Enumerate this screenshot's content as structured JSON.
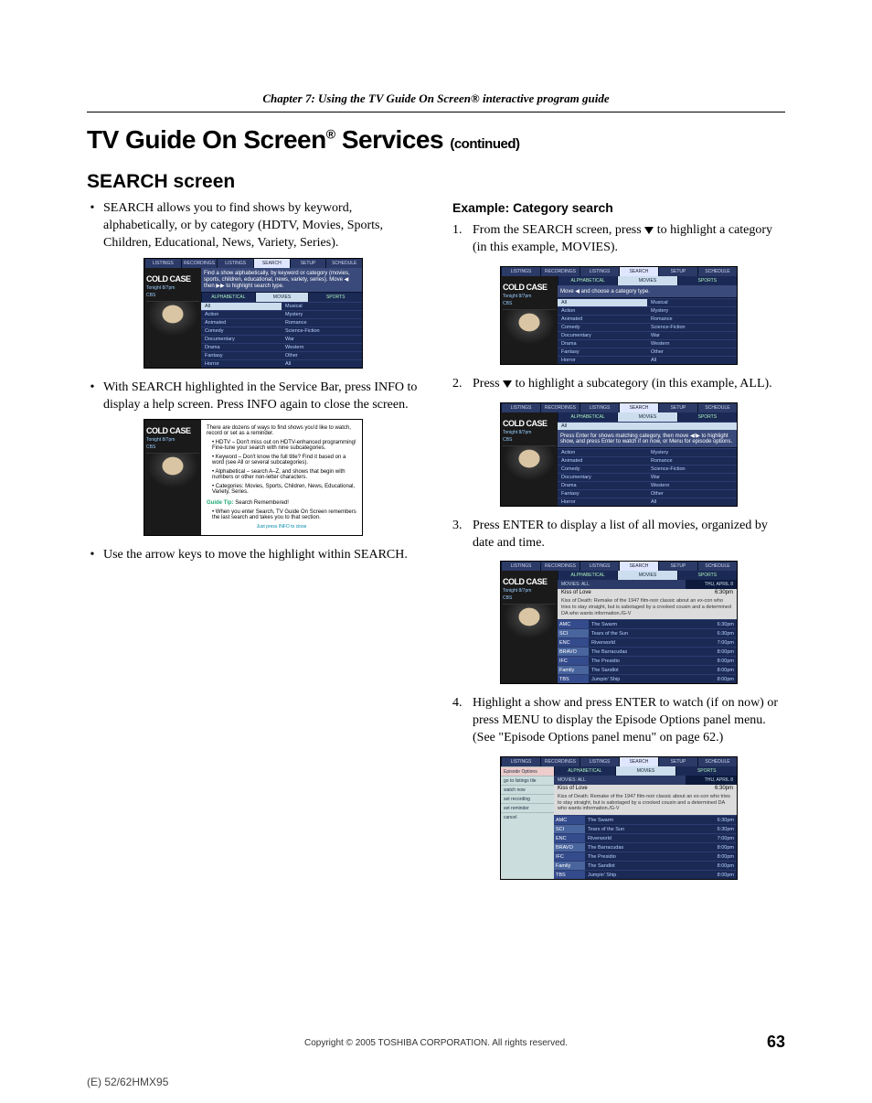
{
  "chapter_head": "Chapter 7: Using the TV Guide On Screen® interactive program guide",
  "section_title_a": "TV Guide On Screen",
  "section_title_b": " Services ",
  "section_title_cont": "(continued)",
  "search_heading": "SEARCH screen",
  "left": {
    "b1": "SEARCH allows you to find shows by keyword, alphabetically, or by category (HDTV, Movies, Sports, Children, Educational, News, Variety, Series).",
    "b2": "With SEARCH highlighted in the Service Bar, press INFO to display a help screen. Press INFO again to close the screen.",
    "b3": "Use the arrow keys to move the highlight within SEARCH."
  },
  "right": {
    "example_head": "Example: Category search",
    "s1a": "From the SEARCH screen, press ",
    "s1b": " to highlight a category (in this example, MOVIES).",
    "s2a": "Press ",
    "s2b": " to highlight a subcategory (in this example, ALL).",
    "s3": "Press ENTER to display a list of all movies, organized by date and time.",
    "s4": "Highlight a show and press ENTER to watch (if on now) or press MENU to display the Episode Options panel menu. (See \"Episode Options panel menu\" on page 62.)"
  },
  "shot_common": {
    "topbar": [
      "LISTINGS",
      "RECORDINGS",
      "LISTINGS",
      "SEARCH",
      "SETUP",
      "SCHEDULE"
    ],
    "catbar": [
      "ALPHABETICAL",
      "MOVIES",
      "SPORTS"
    ],
    "promo_title": "COLD CASE",
    "promo_sub": "Tonight 8/7pm",
    "promo_net": "CBS"
  },
  "shot1": {
    "hint": "Find a show alphabetically, by keyword or category (movies, sports, children, educational, news, variety, series). Move ◀ then ▶▶ to highlight search type.",
    "grid_left": [
      "All",
      "Action",
      "Animated",
      "Comedy",
      "Documentary",
      "Drama",
      "Fantasy",
      "Horror"
    ],
    "grid_right": [
      "Musical",
      "Mystery",
      "Romance",
      "Science-Fiction",
      "War",
      "Western",
      "Other",
      "All"
    ]
  },
  "shot2": {
    "intro": "There are dozens of ways to find shows you'd like to watch, record or set as a reminder.",
    "pts": [
      "HDTV – Don't miss out on HDTV-enhanced programming! Fine-tune your search with nine subcategories.",
      "Keyword – Don't know the full title? Find it based on a word (see All or several subcategories).",
      "Alphabetical – search A–Z, and shows that begin with numbers or other non-letter characters.",
      "Categories: Movies, Sports, Children, News, Educational, Variety, Series."
    ],
    "tip_label": "Guide Tip:",
    "tip_title": " Search Remembered!",
    "tip_body": "When you enter Search, TV Guide On Screen remembers the last search and takes you to that section.",
    "close": "Just press INFO to close"
  },
  "shot3": {
    "hint": "Move ◀ and choose a category type.",
    "grid_left": [
      "All",
      "Action",
      "Animated",
      "Comedy",
      "Documentary",
      "Drama",
      "Fantasy",
      "Horror"
    ],
    "grid_right": [
      "Musical",
      "Mystery",
      "Romance",
      "Science-Fiction",
      "War",
      "Western",
      "Other",
      "All"
    ]
  },
  "shot4": {
    "hdr": "All",
    "hint": "Press Enter for shows matching category, then move ◀/▶ to highlight show, and press Enter to watch if on now, or Menu for episode options.",
    "grid_left": [
      "Action",
      "Animated",
      "Comedy",
      "Documentary",
      "Drama",
      "Fantasy",
      "Horror"
    ],
    "grid_right": [
      "Mystery",
      "Romance",
      "Science-Fiction",
      "War",
      "Western",
      "Other",
      "All"
    ]
  },
  "shot5": {
    "list_hdr_l": "MOVIES: ALL",
    "list_hdr_r": "THU, APRIL 8",
    "feature_title": "Kiss of Love",
    "feature_time": "6:30pm",
    "feature_desc": "Kiss of Death: Remake of the 1947 film-noir classic about an ex-con who tries to stay straight, but is sabotaged by a crooked cousin and a determined DA who wants information./G-V",
    "rows": [
      {
        "ch": "AMC",
        "title": "The Swarm",
        "time": "6:30pm"
      },
      {
        "ch": "SCI",
        "title": "Tears of the Sun",
        "time": "6:30pm"
      },
      {
        "ch": "ENC",
        "title": "Riverworld",
        "time": "7:00pm"
      },
      {
        "ch": "BRAVO",
        "title": "The Barracudas",
        "time": "8:00pm"
      },
      {
        "ch": "IFC",
        "title": "The Presidio",
        "time": "8:00pm"
      },
      {
        "ch": "Family",
        "title": "The Sandlot",
        "time": "8:00pm"
      },
      {
        "ch": "TBS",
        "title": "Jumpin' Ship",
        "time": "8:00pm"
      }
    ]
  },
  "shot6": {
    "opts": [
      "Episode Options",
      "go to listings tile",
      "watch now",
      "set recording",
      "set reminder",
      "cancel"
    ]
  },
  "footer_copy": "Copyright © 2005 TOSHIBA CORPORATION. All rights reserved.",
  "page_number": "63",
  "model": "(E) 52/62HMX95"
}
